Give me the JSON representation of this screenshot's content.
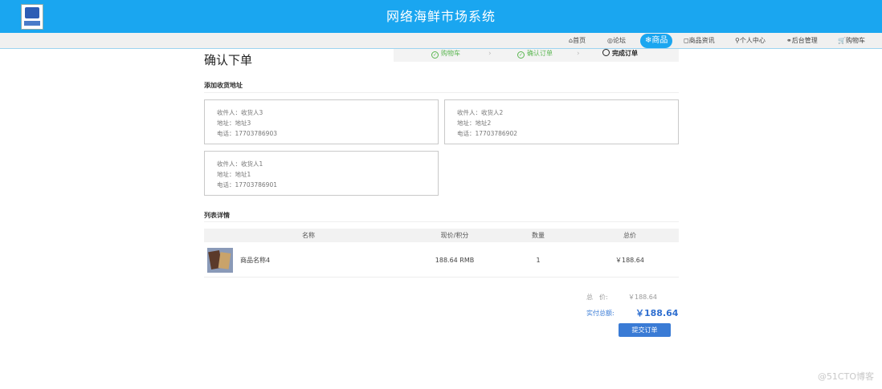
{
  "header": {
    "title": "网络海鲜市场系统"
  },
  "nav": {
    "items": [
      {
        "label": "⌂首页",
        "icon": "home-icon"
      },
      {
        "label": "◎论坛",
        "icon": "forum-icon"
      },
      {
        "label": "❄商品",
        "icon": "snowflake-icon"
      },
      {
        "label": "◻商品资讯",
        "icon": "news-icon"
      },
      {
        "label": "⚲个人中心",
        "icon": "user-icon"
      },
      {
        "label": "⚭后台管理",
        "icon": "link-icon"
      },
      {
        "label": "🛒购物车",
        "icon": "cart-icon"
      }
    ]
  },
  "page": {
    "title": "确认下单"
  },
  "steps": [
    {
      "label": "购物车",
      "mark": "✓"
    },
    {
      "label": "确认订单",
      "mark": "✓"
    },
    {
      "label": "完成订单",
      "mark": ""
    }
  ],
  "address": {
    "section_title": "添加收货地址",
    "cards": [
      {
        "recipient": "收件人：收货人3",
        "address": "地址：地址3",
        "phone": "电话：17703786903"
      },
      {
        "recipient": "收件人：收货人2",
        "address": "地址：地址2",
        "phone": "电话：17703786902"
      },
      {
        "recipient": "收件人：收货人1",
        "address": "地址：地址1",
        "phone": "电话：17703786901"
      }
    ]
  },
  "list": {
    "section_title": "列表详情",
    "headers": [
      "名称",
      "现价/积分",
      "数量",
      "总价"
    ],
    "rows": [
      {
        "name": "商品名称4",
        "price": "188.64 RMB",
        "qty": "1",
        "total": "￥188.64"
      }
    ]
  },
  "summary": {
    "total_label": "总　价:",
    "total_value": "￥188.64",
    "pay_label": "实付总额:",
    "pay_value": "￥188.64",
    "submit_label": "提交订单"
  },
  "watermark": "@51CTO博客",
  "colors": {
    "brand": "#1aa6f0",
    "primary": "#3a7bd5",
    "success": "#5ab650"
  }
}
